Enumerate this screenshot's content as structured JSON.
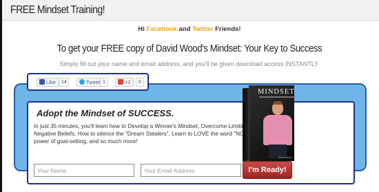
{
  "page": {
    "site_title": "FREE Mindset Training!",
    "greeting": {
      "hi": "Hi",
      "facebook": "Facebook",
      "and": "and",
      "twitter": "Twitter",
      "friends": "Friends!"
    },
    "headline": "To get your FREE copy of David Wood's Mindset: Your Key to Success",
    "subline": "Simply fill out your name and email address, and you'll be given download access INSTANTLY."
  },
  "social": {
    "like_label": "Like",
    "like_count": "14",
    "tweet_label": "Tweet",
    "tweet_count": "1",
    "plus_label": "+1",
    "plus_count": "0"
  },
  "optin": {
    "heading": "Adopt the Mindset of SUCCESS.",
    "body": "In just 35 minutes, you'll learn how to Develop a Winner's Mindset, Overcome Limiting & Negative Beliefs, How to silence the \"Dream Stealers\", Learn to LOVE the word \"NO\", the power of goal-setting, and so much more!",
    "name_placeholder": "Your Name",
    "email_placeholder": "Your Email Address",
    "submit_label": "I'm Ready!"
  },
  "product": {
    "box_title": "MINDSET",
    "author": "David Wood"
  },
  "colors": {
    "accent_orange": "#e8a515",
    "panel_blue": "#6fb5e8",
    "border_navy": "#1c2f8c",
    "button_red": "#b83a35"
  }
}
